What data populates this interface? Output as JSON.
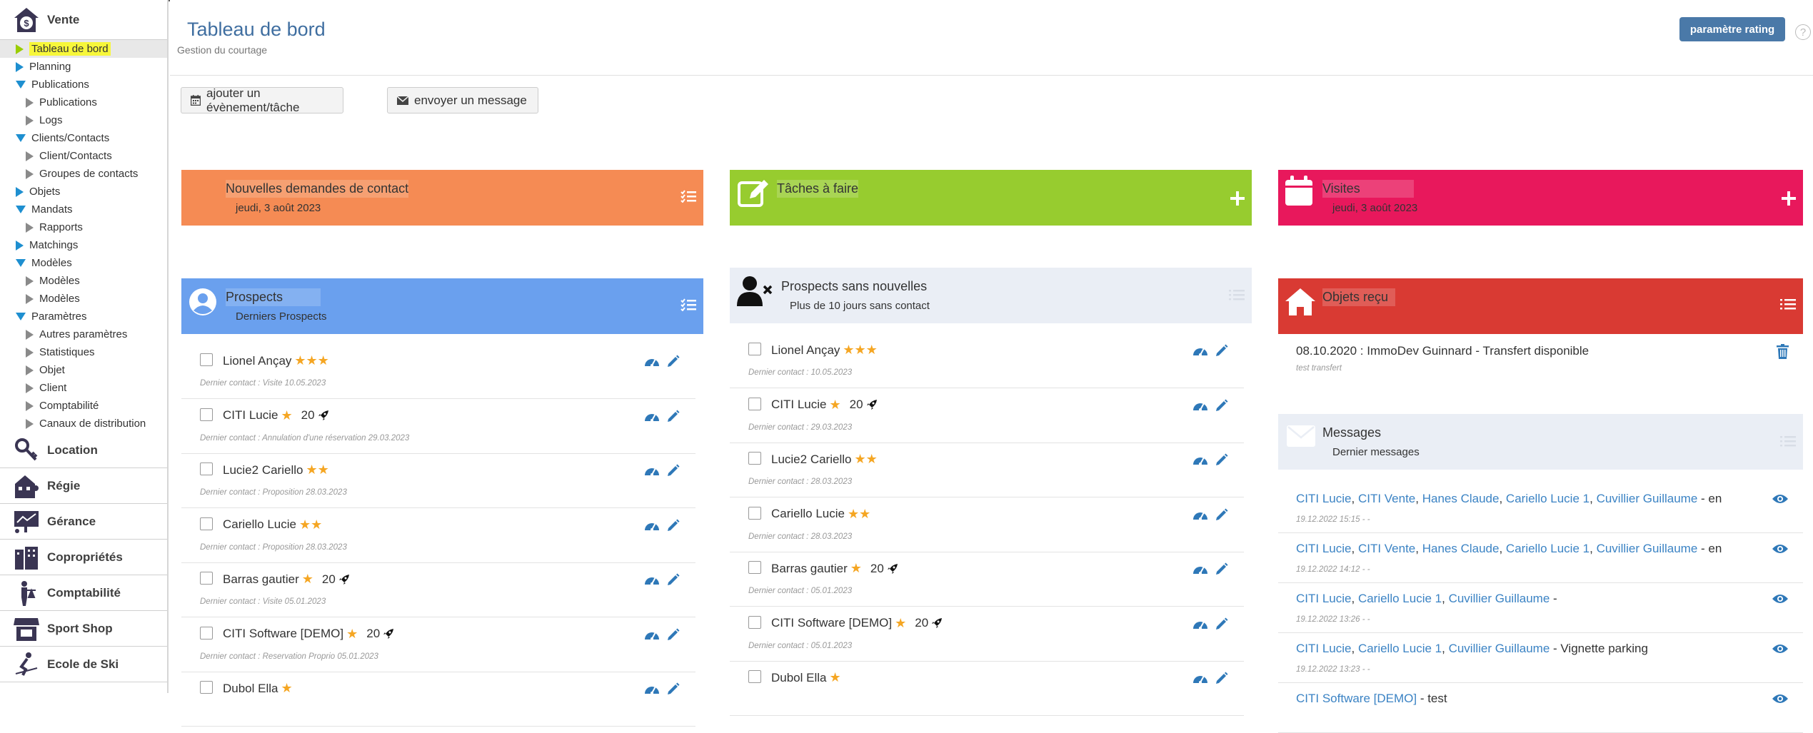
{
  "sidebar": {
    "modules": [
      {
        "label": "Vente",
        "icon": "dollar-house-icon"
      },
      {
        "label": "Location",
        "icon": "key-icon"
      },
      {
        "label": "Régie",
        "icon": "building-person-icon"
      },
      {
        "label": "Gérance",
        "icon": "chart-board-icon"
      },
      {
        "label": "Copropriétés",
        "icon": "buildings-icon"
      },
      {
        "label": "Comptabilité",
        "icon": "person-scale-icon"
      },
      {
        "label": "Sport Shop",
        "icon": "shop-icon"
      },
      {
        "label": "Ecole de Ski",
        "icon": "skier-icon"
      }
    ],
    "tree": [
      {
        "label": "Tableau de bord",
        "level": 1,
        "arrow": "r",
        "active": true
      },
      {
        "label": "Planning",
        "level": 1,
        "arrow": "r"
      },
      {
        "label": "Publications",
        "level": 1,
        "arrow": "d"
      },
      {
        "label": "Publications",
        "level": 2,
        "arrow": "g"
      },
      {
        "label": "Logs",
        "level": 2,
        "arrow": "g"
      },
      {
        "label": "Clients/Contacts",
        "level": 1,
        "arrow": "d"
      },
      {
        "label": "Client/Contacts",
        "level": 2,
        "arrow": "g"
      },
      {
        "label": "Groupes de contacts",
        "level": 2,
        "arrow": "g"
      },
      {
        "label": "Objets",
        "level": 1,
        "arrow": "r"
      },
      {
        "label": "Mandats",
        "level": 1,
        "arrow": "d"
      },
      {
        "label": "Rapports",
        "level": 2,
        "arrow": "g"
      },
      {
        "label": "Matchings",
        "level": 1,
        "arrow": "r"
      },
      {
        "label": "Modèles",
        "level": 1,
        "arrow": "d"
      },
      {
        "label": "Modèles",
        "level": 2,
        "arrow": "g"
      },
      {
        "label": "Modèles",
        "level": 2,
        "arrow": "g"
      },
      {
        "label": "Paramètres",
        "level": 1,
        "arrow": "d"
      },
      {
        "label": "Autres paramètres",
        "level": 2,
        "arrow": "g"
      },
      {
        "label": "Statistiques",
        "level": 2,
        "arrow": "g"
      },
      {
        "label": "Objet",
        "level": 2,
        "arrow": "g"
      },
      {
        "label": "Client",
        "level": 2,
        "arrow": "g"
      },
      {
        "label": "Comptabilité",
        "level": 2,
        "arrow": "g"
      },
      {
        "label": "Canaux de distribution",
        "level": 2,
        "arrow": "g"
      }
    ]
  },
  "header": {
    "title": "Tableau de bord",
    "subtitle": "Gestion du courtage",
    "rating_button": "paramètre rating",
    "help": "?"
  },
  "actions": {
    "add_event": "ajouter un évènement/tâche",
    "send_message": "envoyer un message"
  },
  "panels": {
    "contact_requests": {
      "title": "Nouvelles demandes de contact",
      "subtitle": "jeudi, 3 août 2023"
    },
    "tasks": {
      "title": "Tâches à faire"
    },
    "visits": {
      "title": "Visites",
      "subtitle": "jeudi, 3 août 2023"
    },
    "prospects": {
      "title": "Prospects",
      "subtitle": "Derniers Prospects"
    },
    "prospects_no_news": {
      "title": "Prospects sans nouvelles",
      "subtitle": "Plus de 10 jours sans contact"
    },
    "objects_received": {
      "title": "Objets reçu"
    },
    "messages": {
      "title": "Messages",
      "subtitle": "Dernier messages"
    }
  },
  "prospects": [
    {
      "name": "Lionel Ançay",
      "stars": 3,
      "count": "",
      "last": "Dernier contact : Visite 10.05.2023"
    },
    {
      "name": "CITI Lucie",
      "stars": 1,
      "count": "20",
      "last": "Dernier contact : Annulation d'une réservation 29.03.2023"
    },
    {
      "name": "Lucie2 Cariello",
      "stars": 2,
      "count": "",
      "last": "Dernier contact : Proposition 28.03.2023"
    },
    {
      "name": "Cariello Lucie",
      "stars": 2,
      "count": "",
      "last": "Dernier contact : Proposition 28.03.2023"
    },
    {
      "name": "Barras gautier",
      "stars": 1,
      "count": "20",
      "last": "Dernier contact : Visite 05.01.2023"
    },
    {
      "name": "CITI Software [DEMO]",
      "stars": 1,
      "count": "20",
      "last": "Dernier contact : Reservation Proprio 05.01.2023"
    },
    {
      "name": "Dubol Ella",
      "stars": 1,
      "count": "",
      "last": ""
    }
  ],
  "prospects_no_news": [
    {
      "name": "Lionel Ançay",
      "stars": 3,
      "count": "",
      "last": "Dernier contact : 10.05.2023"
    },
    {
      "name": "CITI Lucie",
      "stars": 1,
      "count": "20",
      "last": "Dernier contact : 29.03.2023"
    },
    {
      "name": "Lucie2 Cariello",
      "stars": 2,
      "count": "",
      "last": "Dernier contact : 28.03.2023"
    },
    {
      "name": "Cariello Lucie",
      "stars": 2,
      "count": "",
      "last": "Dernier contact : 28.03.2023"
    },
    {
      "name": "Barras gautier",
      "stars": 1,
      "count": "20",
      "last": "Dernier contact : 05.01.2023"
    },
    {
      "name": "CITI Software [DEMO]",
      "stars": 1,
      "count": "20",
      "last": "Dernier contact : 05.01.2023"
    },
    {
      "name": "Dubol Ella",
      "stars": 1,
      "count": "",
      "last": ""
    }
  ],
  "objects": [
    {
      "text": "08.10.2020 : ImmoDev Guinnard - Transfert disponible",
      "note": "test transfert"
    }
  ],
  "messages": [
    {
      "links": [
        "CITI Lucie",
        "CITI Vente",
        "Hanes Claude",
        "Cariello Lucie 1",
        "Cuvillier Guillaume"
      ],
      "suffix": " - en",
      "date": "19.12.2022 15:15 - -"
    },
    {
      "links": [
        "CITI Lucie",
        "CITI Vente",
        "Hanes Claude",
        "Cariello Lucie 1",
        "Cuvillier Guillaume"
      ],
      "suffix": " - en",
      "date": "19.12.2022 14:12 - -"
    },
    {
      "links": [
        "CITI Lucie",
        "Cariello Lucie 1",
        "Cuvillier Guillaume"
      ],
      "suffix": " -",
      "date": "19.12.2022 13:26 - -"
    },
    {
      "links": [
        "CITI Lucie",
        "Cariello Lucie 1",
        "Cuvillier Guillaume"
      ],
      "suffix": " - Vignette parking",
      "date": "19.12.2022 13:23 - -"
    },
    {
      "links": [
        "CITI Software [DEMO]"
      ],
      "suffix": " - test",
      "date": ""
    }
  ],
  "colors": {
    "orange": "#f58b54",
    "green": "#97cc2f",
    "pink": "#e8185c",
    "blue": "#6aa0ee",
    "red": "#d93a33",
    "link": "#3b83c4",
    "star": "#f5a623",
    "icon_blue": "#2e78b8"
  }
}
